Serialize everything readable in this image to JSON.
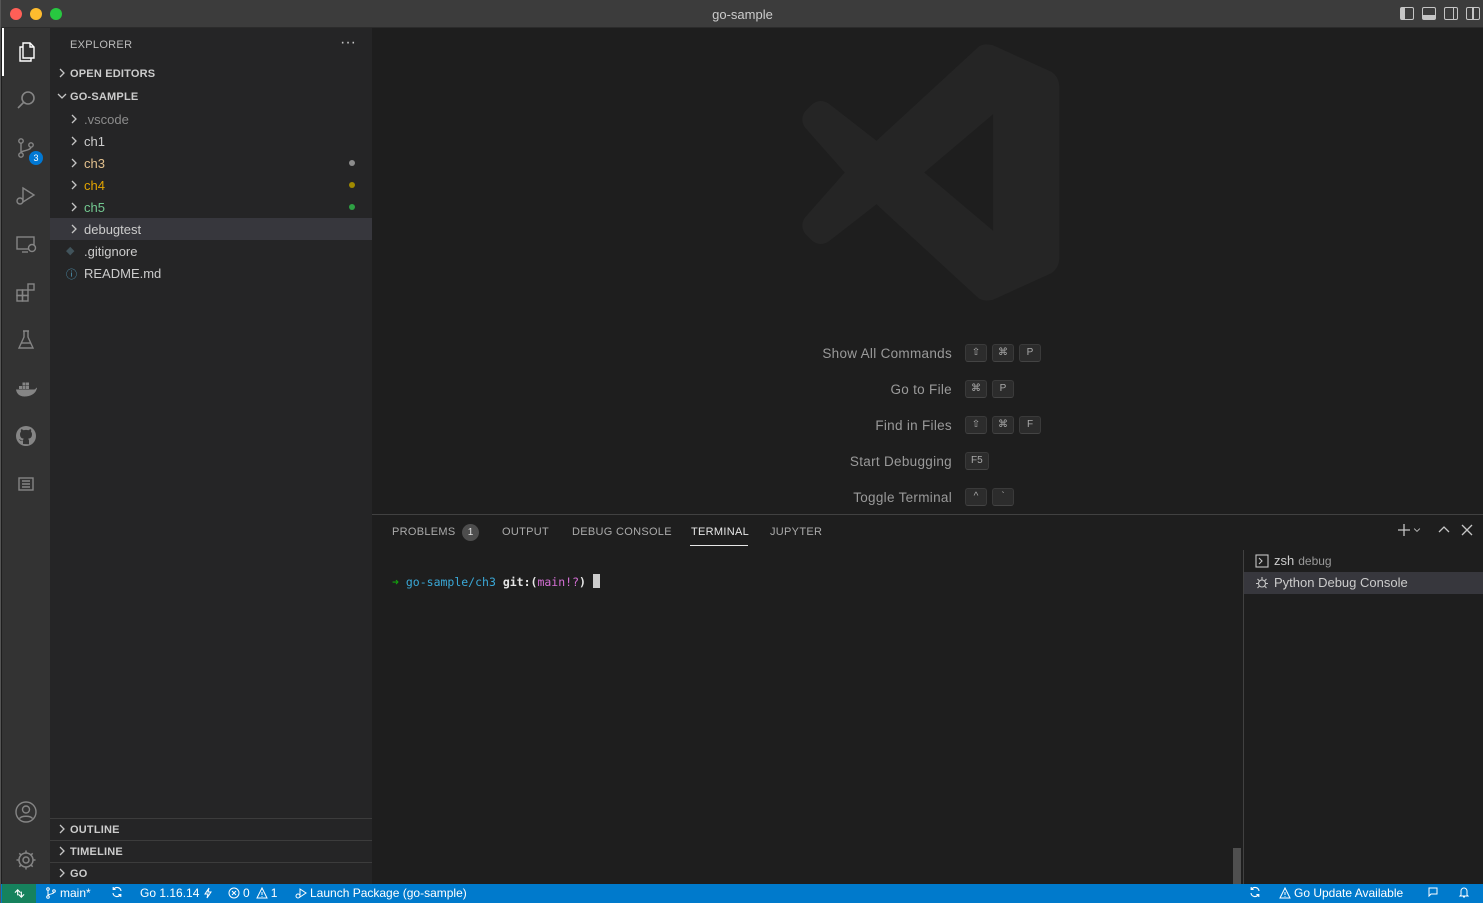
{
  "window": {
    "title": "go-sample"
  },
  "activity_bar": {
    "items": [
      {
        "icon": "files-icon",
        "active": true
      },
      {
        "icon": "search-icon"
      },
      {
        "icon": "source-control-icon",
        "badge": "3"
      },
      {
        "icon": "run-debug-icon"
      },
      {
        "icon": "remote-explorer-icon"
      },
      {
        "icon": "extensions-icon"
      },
      {
        "icon": "testing-icon"
      },
      {
        "icon": "docker-icon"
      },
      {
        "icon": "github-icon"
      },
      {
        "icon": "notes-icon"
      }
    ],
    "bottom": [
      {
        "icon": "account-icon"
      },
      {
        "icon": "manage-gear-icon"
      }
    ]
  },
  "sidebar": {
    "title": "EXPLORER",
    "more": "···",
    "open_editors": "OPEN EDITORS",
    "workspace": "GO-SAMPLE",
    "tree": [
      {
        "name": ".vscode",
        "type": "folder",
        "color": "#8c8c8c"
      },
      {
        "name": "ch1",
        "type": "folder",
        "color": "#cccccc"
      },
      {
        "name": "ch3",
        "type": "folder",
        "color": "#e2c08d",
        "dot": "#8c8c8c"
      },
      {
        "name": "ch4",
        "type": "folder",
        "color": "#e2a400",
        "dot": "#a08a00"
      },
      {
        "name": "ch5",
        "type": "folder",
        "color": "#73c991",
        "dot": "#2ea043"
      },
      {
        "name": "debugtest",
        "type": "folder",
        "color": "#cccccc",
        "selected": true
      },
      {
        "name": ".gitignore",
        "type": "file",
        "icon": "◆",
        "icon_color": "#41535b",
        "color": "#cccccc"
      },
      {
        "name": "README.md",
        "type": "file",
        "icon": "ⓘ",
        "icon_color": "#519aba",
        "color": "#cccccc"
      }
    ],
    "outline": "OUTLINE",
    "timeline": "TIMELINE",
    "go": "GO"
  },
  "editor": {
    "shortcuts": [
      {
        "label": "Show All Commands",
        "keys": [
          "⇧",
          "⌘",
          "P"
        ]
      },
      {
        "label": "Go to File",
        "keys": [
          "⌘",
          "P"
        ]
      },
      {
        "label": "Find in Files",
        "keys": [
          "⇧",
          "⌘",
          "F"
        ]
      },
      {
        "label": "Start Debugging",
        "keys": [
          "F5"
        ]
      },
      {
        "label": "Toggle Terminal",
        "keys": [
          "^",
          "`"
        ]
      }
    ]
  },
  "panel": {
    "tabs": [
      {
        "label": "PROBLEMS",
        "badge": "1"
      },
      {
        "label": "OUTPUT"
      },
      {
        "label": "DEBUG CONSOLE"
      },
      {
        "label": "TERMINAL",
        "active": true
      },
      {
        "label": "JUPYTER"
      }
    ],
    "terminal": {
      "arrow": "➜",
      "dir": "go-sample/ch3",
      "git_prefix": "git:(",
      "branch": "main!?",
      "git_suffix": ")"
    },
    "terminals": [
      {
        "name": "zsh",
        "sub": "debug",
        "icon": "terminal-icon"
      },
      {
        "name": "Python Debug Console",
        "sub": "",
        "icon": "debug-bug-icon",
        "selected": true
      }
    ]
  },
  "statusbar": {
    "branch": "main*",
    "go_version": "Go 1.16.14",
    "errors": "0",
    "warnings": "1",
    "launch": "Launch Package (go-sample)",
    "go_update": "Go Update Available"
  }
}
